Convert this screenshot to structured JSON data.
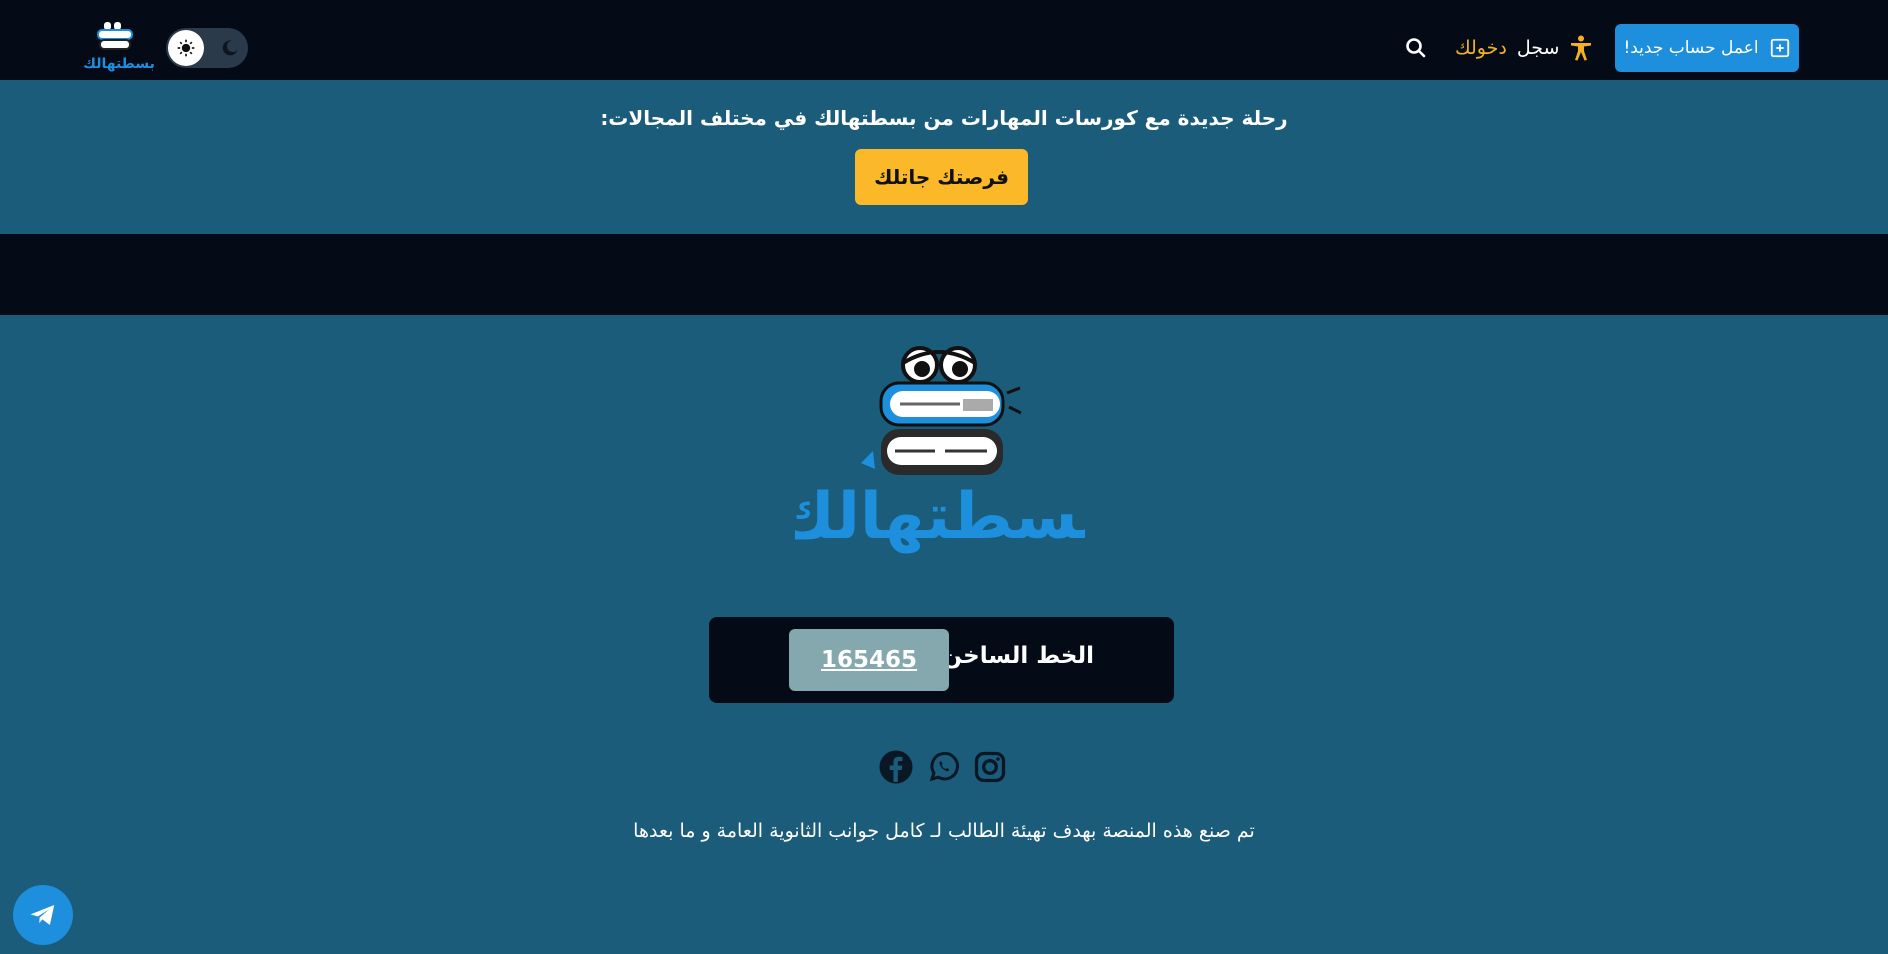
{
  "navbar": {
    "signup_label": "اعمل حساب جديد!",
    "login_prefix": "سجل",
    "login_accent": "دخولك",
    "logo_text": "بسطتهالك"
  },
  "banner": {
    "text": "رحلة جديدة مع كورسات المهارات من بسطتهالك في مختلف المجالات:",
    "cta_label": "فرصتك جاتلك"
  },
  "footer": {
    "logo_text": "بسطتهالك",
    "hotline_label": "الخط الساخن :",
    "hotline_number": "165465",
    "description": "تم صنع هذه المنصة بهدف تهيئة الطالب لـ كامل جوانب الثانوية العامة و ما بعدها",
    "socials": [
      "facebook-icon",
      "whatsapp-icon",
      "instagram-icon"
    ]
  },
  "colors": {
    "navbar_bg": "#050b16",
    "page_bg": "#1a5c7a",
    "primary": "#1d8fdc",
    "accent": "#fbb829"
  }
}
